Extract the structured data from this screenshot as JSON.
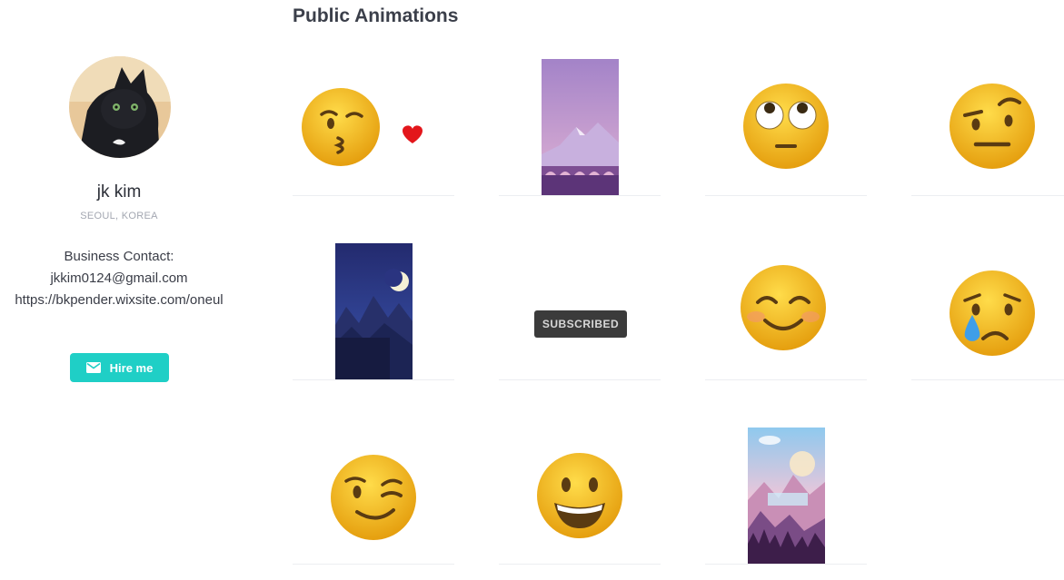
{
  "profile": {
    "name": "jk kim",
    "location": "SEOUL, KOREA",
    "contact_heading": "Business Contact:",
    "email": "jkkim0124@gmail.com",
    "website": "https://bkpender.wixsite.com/oneul",
    "hire_label": "Hire me",
    "hire_icon": "mail-icon"
  },
  "section_title": "Public Animations",
  "animations": [
    {
      "icon": "kissing-face-heart-emoji"
    },
    {
      "icon": "purple-mountain-bridge-scene"
    },
    {
      "icon": "eye-roll-emoji"
    },
    {
      "icon": "raised-eyebrow-emoji"
    },
    {
      "icon": "night-moon-mountains-scene"
    },
    {
      "icon": "subscribed-badge",
      "badge_label": "SUBSCRIBED"
    },
    {
      "icon": "smiling-blush-emoji"
    },
    {
      "icon": "crying-tear-emoji"
    },
    {
      "icon": "winking-face-emoji"
    },
    {
      "icon": "grinning-face-emoji"
    },
    {
      "icon": "pastel-mountain-forest-scene"
    }
  ],
  "colors": {
    "accent": "#1fcfc6",
    "emoji_yellow": "#f7c21b",
    "title_text": "#3b3f4a"
  }
}
